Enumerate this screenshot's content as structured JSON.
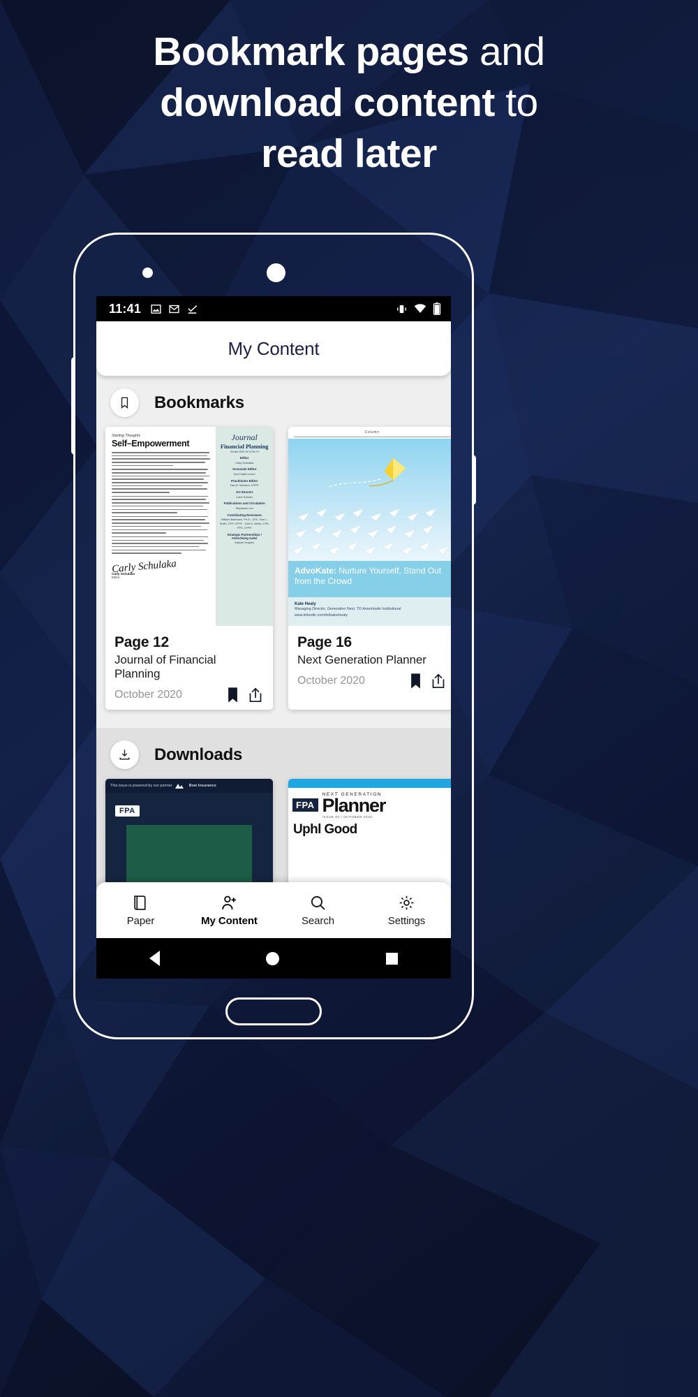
{
  "promo": {
    "headline_lines": [
      [
        {
          "t": "Bookmark pages",
          "b": true
        },
        {
          "t": " and",
          "b": false
        }
      ],
      [
        {
          "t": "download content",
          "b": true
        },
        {
          "t": " to",
          "b": false
        }
      ],
      [
        {
          "t": "read later",
          "b": true
        }
      ]
    ],
    "headline_plain": "Bookmark pages and download content to read later",
    "background_color": "#111b36",
    "text_color": "#ffffff"
  },
  "statusbar": {
    "time": "11:41",
    "left_icons": [
      "image-icon",
      "gmail-icon",
      "task-complete-icon"
    ],
    "right_icons": [
      "vibrate-icon",
      "wifi-icon",
      "battery-icon"
    ],
    "background_color": "#000000"
  },
  "appbar": {
    "title": "My Content"
  },
  "sections": [
    {
      "id": "bookmarks",
      "label": "Bookmarks",
      "icon": "bookmark-icon",
      "cards": [
        {
          "page": "Page 12",
          "publication": "Journal of Financial Planning",
          "date": "October 2020",
          "actions": [
            "bookmark-filled-icon",
            "share-icon"
          ],
          "thumb": {
            "kind": "journal-article",
            "kicker": "Starting Thoughts",
            "title": "Self–Empowerment",
            "logo_line1": "Journal",
            "logo_line2": "Financial Planning",
            "logo_line3": "October 2020, Vol 33 No 10",
            "masthead": [
              {
                "h": "Editor",
                "n": "Carly Schulaka"
              },
              {
                "h": "Associate Editor",
                "n": "Ana Trujillo Limón"
              },
              {
                "h": "Practitioner Editor",
                "n": "Dan B. Moisand, CFP®"
              },
              {
                "h": "Art Director",
                "n": "Carol Schmitz"
              },
              {
                "h": "Publications and Circulation",
                "n": "Stephanie Lee"
              },
              {
                "h": "Contributing Reviewers",
                "n": "William Bachrach, Ph.D., CFA · Dan L. Smith, CFP, CFP® · Julie A. Welch, CPA, PFS, CFP®"
              },
              {
                "h": "Strategic Partnerships / Advertising Sales",
                "n": "Marcee Hughes"
              }
            ],
            "signature": "Carly Schulaka",
            "signature_role": "Editor"
          }
        },
        {
          "page": "Page 16",
          "publication": "Next Generation Planner",
          "date": "October 2020",
          "actions": [
            "bookmark-filled-icon",
            "share-icon"
          ],
          "thumb": {
            "kind": "kite-column",
            "column_label": "Column",
            "headline_bold": "AdvoKate:",
            "headline_rest": " Nurture Yourself, Stand Out from the Crowd",
            "author": "Kate Healy",
            "author_title": "Managing Director, Generation Next, TD Ameritrade Institutional",
            "author_link": "www.linkedin.com/in/katoehealy"
          }
        }
      ]
    },
    {
      "id": "downloads",
      "label": "Downloads",
      "icon": "download-icon",
      "cards": [
        {
          "thumb": {
            "kind": "journal-cover",
            "partner_text": "This issue is powered by our partner",
            "partner_name": "Bow Insurance",
            "brand": "FPA"
          }
        },
        {
          "thumb": {
            "kind": "planner-cover",
            "brand": "FPA",
            "eyebrow": "NEXT GENERATION",
            "title": "Planner",
            "issue": "ISSUE 20 | OCTOBER 2020",
            "headline": "Uphl Good"
          }
        }
      ]
    }
  ],
  "bottomnav": {
    "items": [
      {
        "label": "Paper",
        "icon": "book-icon",
        "active": false
      },
      {
        "label": "My Content",
        "icon": "person-add-icon",
        "active": true
      },
      {
        "label": "Search",
        "icon": "search-icon",
        "active": false
      },
      {
        "label": "Settings",
        "icon": "gear-icon",
        "active": false
      }
    ]
  },
  "sysnav": {
    "items": [
      "back-triangle-icon",
      "home-circle-icon",
      "recents-square-icon"
    ]
  }
}
